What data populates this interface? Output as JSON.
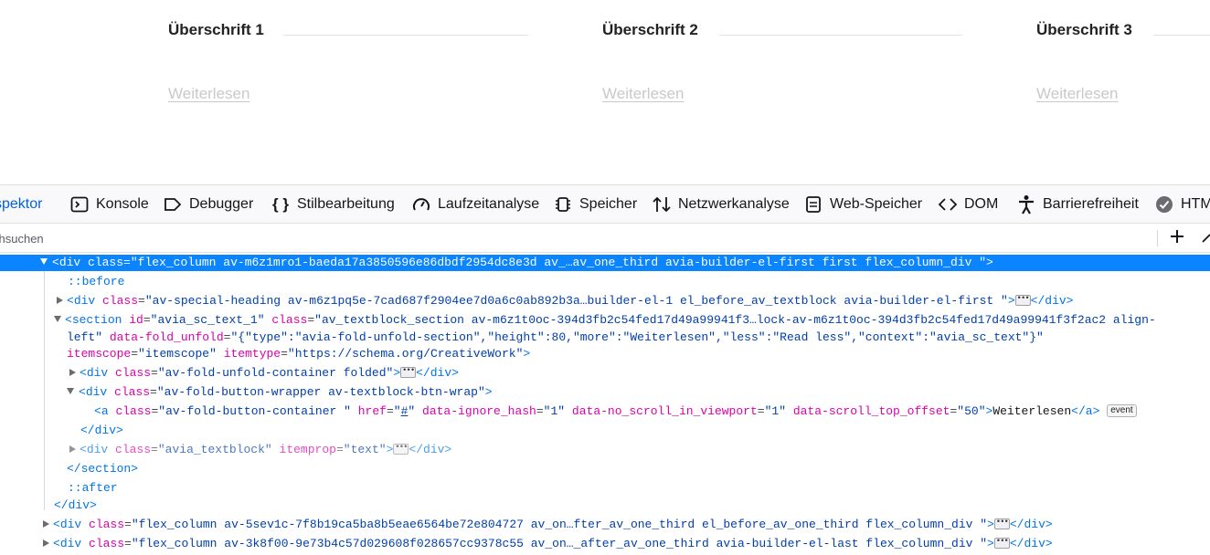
{
  "preview": {
    "columns": [
      {
        "heading": "Überschrift 1",
        "link": "Weiterlesen"
      },
      {
        "heading": "Überschrift 2",
        "link": "Weiterlesen"
      },
      {
        "heading": "Überschrift 3",
        "link": "Weiterlesen"
      }
    ]
  },
  "toolbar": {
    "tabs": [
      {
        "label": "spektor",
        "icon": "inspector-icon"
      },
      {
        "label": "Konsole",
        "icon": "console-icon"
      },
      {
        "label": "Debugger",
        "icon": "debugger-icon"
      },
      {
        "label": "Stilbearbeitung",
        "icon": "braces-icon"
      },
      {
        "label": "Laufzeitanalyse",
        "icon": "gauge-icon"
      },
      {
        "label": "Speicher",
        "icon": "memory-chip-icon"
      },
      {
        "label": "Netzwerkanalyse",
        "icon": "arrows-updown-icon"
      },
      {
        "label": "Web-Speicher",
        "icon": "storage-icon"
      },
      {
        "label": "DOM",
        "icon": "code-brackets-icon"
      },
      {
        "label": "Barrierefreiheit",
        "icon": "accessibility-icon"
      },
      {
        "label": "HTM",
        "icon": "check-badge-icon"
      }
    ]
  },
  "search": {
    "placeholder": "chsuchen"
  },
  "tree": {
    "row1": {
      "tag": "div",
      "class": "flex_column av-m6z1mro1-baeda17a3850596e86dbdf2954dc8e3d av_…av_one_third avia-builder-el-first first flex_column_div "
    },
    "row2": {
      "pseudo": "::before"
    },
    "row3": {
      "tag": "div",
      "class": "av-special-heading av-m6z1pq5e-7cad687f2904ee7d0a6c0ab892b3a…builder-el-1 el_before_av_textblock avia-builder-el-first "
    },
    "row4": {
      "tag": "section",
      "id": "avia_sc_text_1",
      "class": "av_textblock_section av-m6z1t0oc-394d3fb2c54fed17d49a99941f3…lock-av-m6z1t0oc-394d3fb2c54fed17d49a99941f3f2ac2 align-"
    },
    "row5": {
      "cont": "left\""
    },
    "row6": {
      "attr": "data-fold_unfold",
      "value": "{\"type\":\"avia-fold-unfold-section\",\"height\":80,\"more\":\"Weiterlesen\",\"less\":\"Read less\",\"context\":\"avia_sc_text\"}"
    },
    "row7": {
      "attr1": "itemscope",
      "value1": "itemscope",
      "attr2": "itemtype",
      "value2": "https://schema.org/CreativeWork"
    },
    "row8": {
      "tag": "div",
      "class": "av-fold-unfold-container folded"
    },
    "row9": {
      "tag": "div",
      "class": "av-fold-button-wrapper av-textblock-btn-wrap"
    },
    "row10": {
      "tag": "a",
      "class": "av-fold-button-container ",
      "href": "#",
      "ignore_hash": "1",
      "no_scroll": "1",
      "scroll_top": "50",
      "text": "Weiterlesen",
      "badge": "event"
    },
    "row11": {
      "close": "div"
    },
    "row12": {
      "tag": "div",
      "class": "avia_textblock",
      "itemprop": "text"
    },
    "row13": {
      "close": "section"
    },
    "row14": {
      "pseudo": "::after"
    },
    "row15": {
      "close": "div"
    },
    "row16": {
      "tag": "div",
      "class": "flex_column av-5sev1c-7f8b19ca5ba8b5eae6564be72e804727 av_on…fter_av_one_third el_before_av_one_third flex_column_div "
    },
    "row17": {
      "tag": "div",
      "class": "flex_column av-3k8f00-9e73b4c57d029608f028657cc9378c55 av_on…_after_av_one_third avia-builder-el-last flex_column_div "
    }
  },
  "colors": {
    "accent": "#0061e0",
    "selection": "#0a84ff",
    "tag": "#0074e8",
    "attr_name": "#dd00a9",
    "attr_value": "#003eaa"
  }
}
